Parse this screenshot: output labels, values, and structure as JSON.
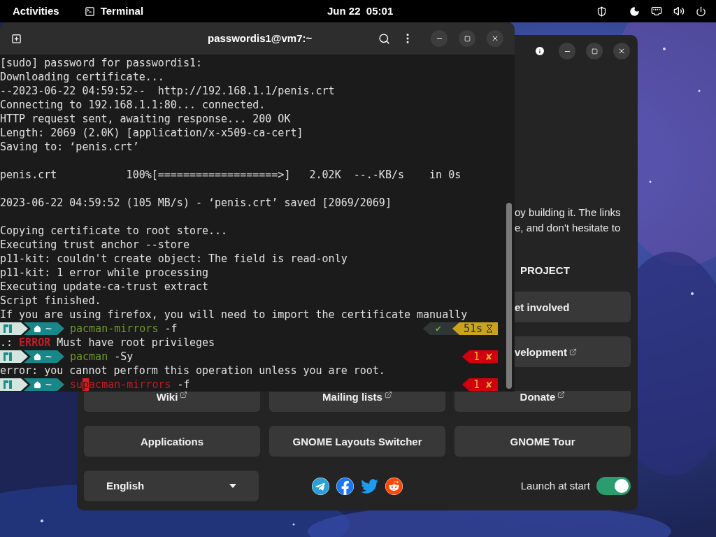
{
  "top_bar": {
    "activities": "Activities",
    "app": "Terminal",
    "clock": "Jun 22  05:01"
  },
  "welcome_window": {
    "intro_lines": [
      "oy building it. The links",
      "e, and don't hesitate to"
    ],
    "section_title": "PROJECT",
    "project_buttons": [
      {
        "label": "et involved",
        "external": false
      },
      {
        "label": "velopment",
        "external": true
      }
    ],
    "buttons": [
      {
        "label": "Wiki",
        "external": true
      },
      {
        "label": "Mailing lists",
        "external": true
      },
      {
        "label": "Donate",
        "external": true
      },
      {
        "label": "Applications",
        "external": false
      },
      {
        "label": "GNOME Layouts Switcher",
        "external": false
      },
      {
        "label": "GNOME Tour",
        "external": false
      }
    ],
    "language": {
      "value": "English"
    },
    "launch_at_start": {
      "label": "Launch at start",
      "on": true
    }
  },
  "terminal": {
    "title": "passwordis1@vm7:~",
    "lines": [
      {
        "kind": "text",
        "text": "[sudo] password for passwordis1:"
      },
      {
        "kind": "text",
        "text": "Downloading certificate..."
      },
      {
        "kind": "text",
        "text": "--2023-06-22 04:59:52--  http://192.168.1.1/penis.crt"
      },
      {
        "kind": "text",
        "text": "Connecting to 192.168.1.1:80... connected."
      },
      {
        "kind": "text",
        "text": "HTTP request sent, awaiting response... 200 OK"
      },
      {
        "kind": "text",
        "text": "Length: 2069 (2.0K) [application/x-x509-ca-cert]"
      },
      {
        "kind": "text",
        "text": "Saving to: ‘penis.crt’"
      },
      {
        "kind": "blank"
      },
      {
        "kind": "text",
        "text": "penis.crt           100%[===================>]   2.02K  --.-KB/s    in 0s"
      },
      {
        "kind": "blank"
      },
      {
        "kind": "text",
        "text": "2023-06-22 04:59:52 (105 MB/s) - ‘penis.crt’ saved [2069/2069]"
      },
      {
        "kind": "blank"
      },
      {
        "kind": "text",
        "text": "Copying certificate to root store..."
      },
      {
        "kind": "text",
        "text": "Executing trust anchor --store"
      },
      {
        "kind": "text",
        "text": "p11-kit: couldn't create object: The field is read-only"
      },
      {
        "kind": "text",
        "text": "p11-kit: 1 error while processing"
      },
      {
        "kind": "text",
        "text": "Executing update-ca-trust extract"
      },
      {
        "kind": "text",
        "text": "Script finished."
      },
      {
        "kind": "text",
        "text": "If you are using firefox, you will need to import the certificate manually"
      },
      {
        "kind": "prompt",
        "dir": "~",
        "valid": true,
        "command": [
          {
            "text": "pacman-mirrors",
            "cursor": false
          }
        ],
        "args": " -f",
        "status": {
          "ok": true,
          "mark": "✔",
          "duration": "51s"
        }
      },
      {
        "kind": "error",
        "prefix": ".: ",
        "label": "ERROR",
        "text": " Must have root privileges"
      },
      {
        "kind": "prompt",
        "dir": "~",
        "valid": true,
        "command": [
          {
            "text": "pacman",
            "cursor": false
          }
        ],
        "args": " -Sy",
        "status": {
          "ok": false,
          "code": "1",
          "mark": "✘"
        }
      },
      {
        "kind": "text",
        "text": "error: you cannot perform this operation unless you are root."
      },
      {
        "kind": "prompt",
        "dir": "~",
        "valid": false,
        "command": [
          {
            "text": "su",
            "cursor": false
          },
          {
            "text": "p",
            "cursor": true
          },
          {
            "text": "acman-mirrors",
            "cursor": false
          }
        ],
        "args": " -f",
        "status": {
          "ok": false,
          "code": "1",
          "mark": "✘"
        }
      }
    ]
  }
}
